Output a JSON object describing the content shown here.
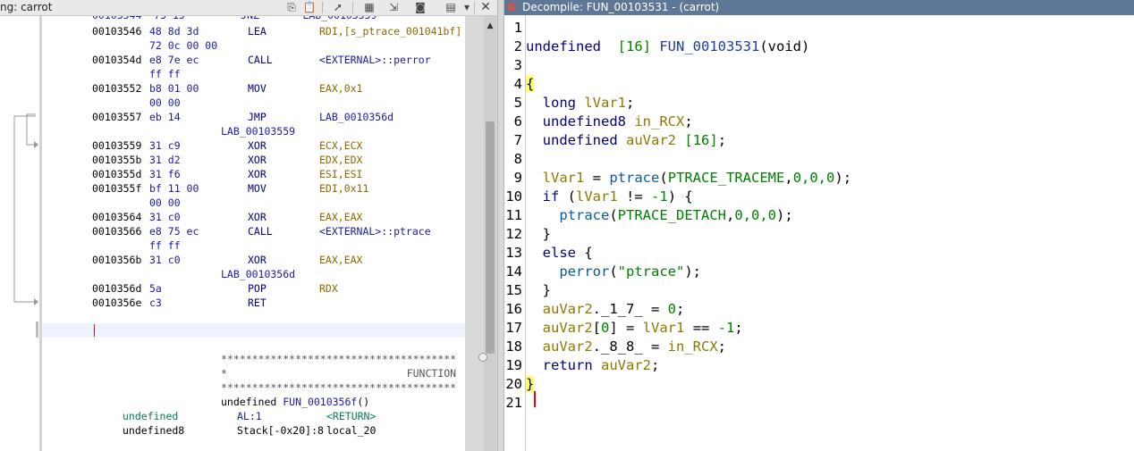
{
  "left_panel": {
    "title": "ng:  carrot",
    "toolbar": [
      "copy",
      "paste",
      "select",
      "edit-listing",
      "snapshot",
      "menu",
      "close"
    ],
    "close_label": "✕",
    "listing": {
      "rows": [
        {
          "addr": "00103546",
          "bytes": "48 8d 3d",
          "mnem": "LEA",
          "oper": "RDI,[s_ptrace_001041bf]"
        },
        {
          "addr": "",
          "bytes": "72 0c 00 00",
          "mnem": "",
          "oper": ""
        },
        {
          "addr": "0010354d",
          "bytes": "e8 7e ec",
          "mnem": "CALL",
          "oper": "<EXTERNAL>::perror"
        },
        {
          "addr": "",
          "bytes": "ff ff",
          "mnem": "",
          "oper": ""
        },
        {
          "addr": "00103552",
          "bytes": "b8 01 00",
          "mnem": "MOV",
          "oper": "EAX,0x1"
        },
        {
          "addr": "",
          "bytes": "00 00",
          "mnem": "",
          "oper": ""
        },
        {
          "addr": "00103557",
          "bytes": "eb 14",
          "mnem": "JMP",
          "oper": "LAB_0010356d"
        },
        {
          "label": "LAB_00103559"
        },
        {
          "addr": "00103559",
          "bytes": "31 c9",
          "mnem": "XOR",
          "oper": "ECX,ECX"
        },
        {
          "addr": "0010355b",
          "bytes": "31 d2",
          "mnem": "XOR",
          "oper": "EDX,EDX"
        },
        {
          "addr": "0010355d",
          "bytes": "31 f6",
          "mnem": "XOR",
          "oper": "ESI,ESI"
        },
        {
          "addr": "0010355f",
          "bytes": "bf 11 00",
          "mnem": "MOV",
          "oper": "EDI,0x11"
        },
        {
          "addr": "",
          "bytes": "00 00",
          "mnem": "",
          "oper": ""
        },
        {
          "addr": "00103564",
          "bytes": "31 c0",
          "mnem": "XOR",
          "oper": "EAX,EAX"
        },
        {
          "addr": "00103566",
          "bytes": "e8 75 ec",
          "mnem": "CALL",
          "oper": "<EXTERNAL>::ptrace"
        },
        {
          "addr": "",
          "bytes": "ff ff",
          "mnem": "",
          "oper": ""
        },
        {
          "addr": "0010356b",
          "bytes": "31 c0",
          "mnem": "XOR",
          "oper": "EAX,EAX"
        },
        {
          "label": "LAB_0010356d"
        },
        {
          "addr": "0010356d",
          "bytes": "5a",
          "mnem": "POP",
          "oper": "RDX"
        },
        {
          "addr": "0010356e",
          "bytes": "c3",
          "mnem": "RET",
          "oper": ""
        }
      ],
      "stars_line": "**************************************",
      "function_marker": "*                             FUNCTION",
      "signature_type": "undefined ",
      "signature_name": "FUN_0010356f",
      "signature_args": "()",
      "var_rows": [
        {
          "type": "undefined",
          "loc": "AL:1",
          "name": "<RETURN>"
        },
        {
          "type": "undefined8",
          "loc": "Stack[-0x20]:8",
          "name": "local_20"
        }
      ]
    },
    "scroll_up": "▲",
    "scroll_down": "▼"
  },
  "right_panel": {
    "title": "Decompile: FUN_00103531 -  (carrot)",
    "icon_glyph": "G",
    "line_numbers": [
      "1",
      "2",
      "3",
      "4",
      "5",
      "6",
      "7",
      "8",
      "9",
      "10",
      "11",
      "12",
      "13",
      "14",
      "15",
      "16",
      "17",
      "18",
      "19",
      "20",
      "21"
    ],
    "code": {
      "l2": {
        "type": "undefined",
        "size": "[16]",
        "name": "FUN_00103531",
        "args": "(void)"
      },
      "l5": {
        "type": "long",
        "var": "lVar1"
      },
      "l6": {
        "type": "undefined8",
        "var": "in_RCX"
      },
      "l7": {
        "type": "undefined",
        "var": "auVar2",
        "size": "[16]"
      },
      "l9": {
        "var": "lVar1",
        "fn": "ptrace",
        "const": "PTRACE_TRACEME",
        "args": "0,0,0"
      },
      "l10": {
        "kw": "if",
        "var": "lVar1",
        "op": "!=",
        "num": "-1"
      },
      "l11": {
        "fn": "ptrace",
        "const": "PTRACE_DETACH",
        "args": "0,0,0"
      },
      "l13": {
        "kw": "else"
      },
      "l14": {
        "fn": "perror",
        "str": "\"ptrace\""
      },
      "l16": {
        "var": "auVar2",
        "field": "._1_7_",
        "num": "0"
      },
      "l17": {
        "var": "auVar2",
        "idx": "0",
        "var2": "lVar1",
        "op": "==",
        "num": "-1"
      },
      "l18": {
        "var": "auVar2",
        "field": "._8_8_",
        "var2": "in_RCX"
      },
      "l19": {
        "kw": "return",
        "var": "auVar2"
      }
    }
  }
}
